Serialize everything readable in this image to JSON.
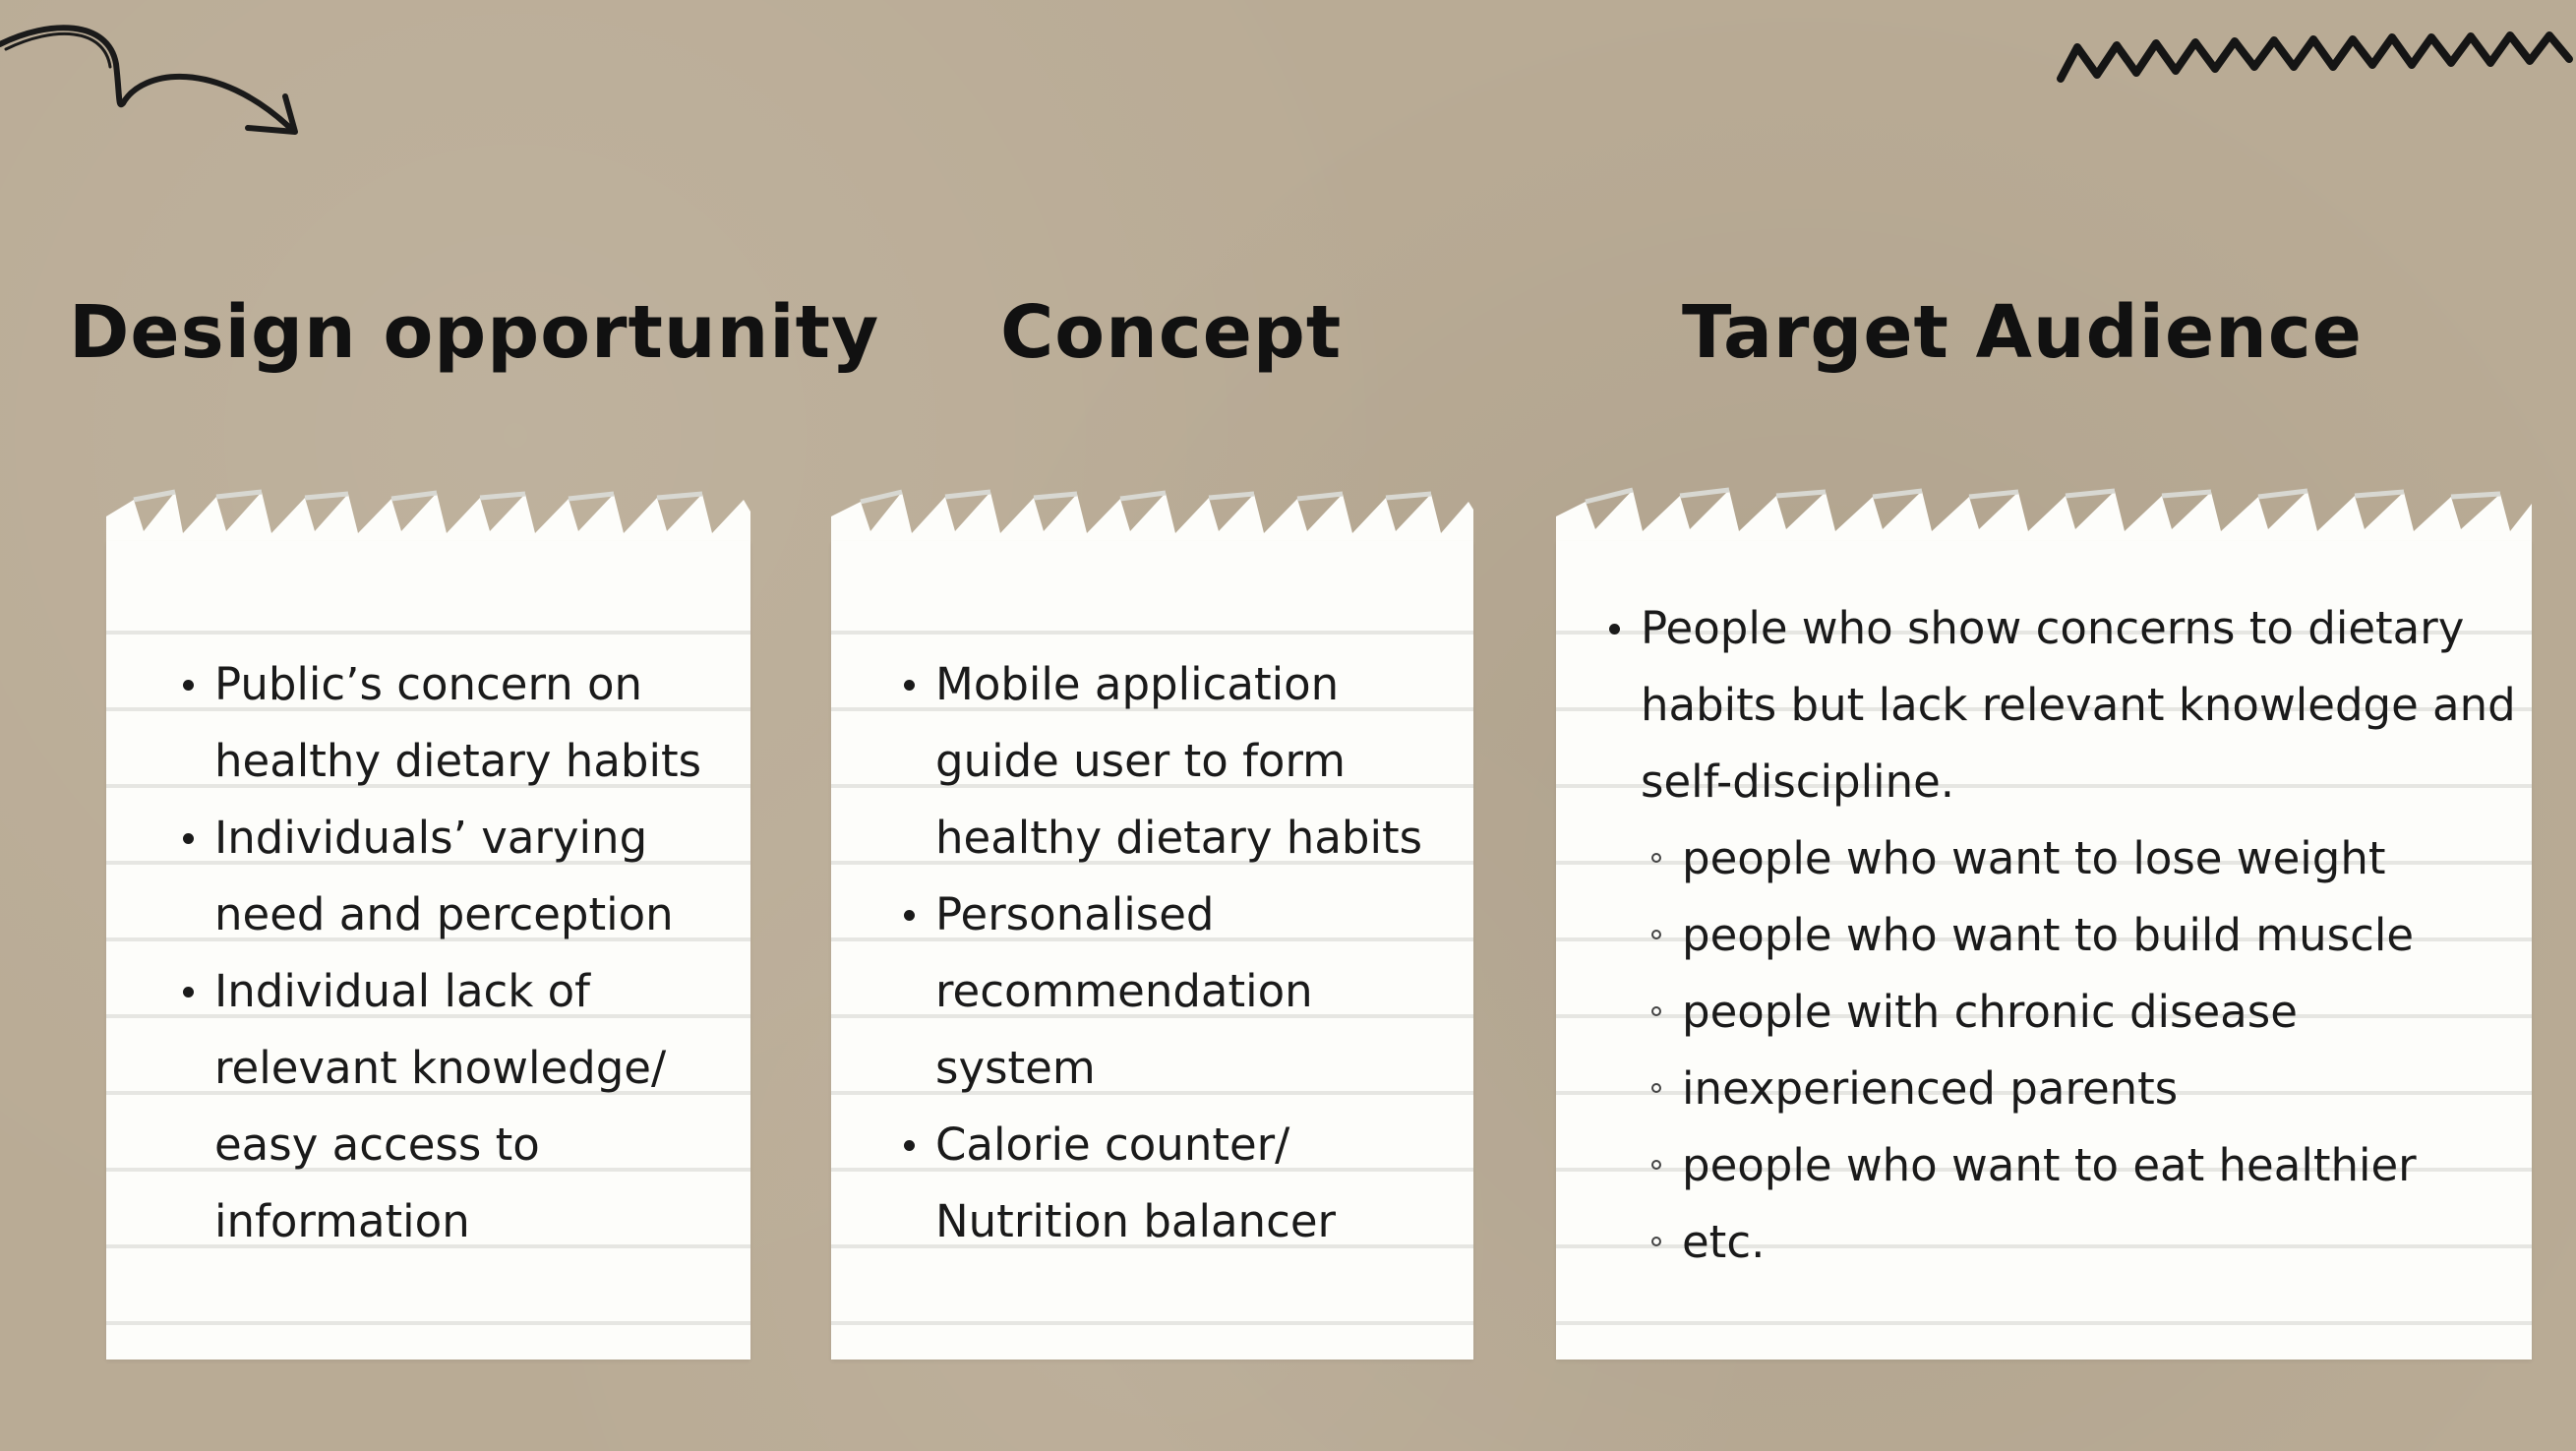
{
  "colors": {
    "background": "#b9ab95",
    "paper": "#fdfdfa",
    "rule_line": "#e6e6e2",
    "text": "#111111"
  },
  "decorations": [
    "curved-arrow-doodle",
    "zigzag-doodle"
  ],
  "sections": [
    {
      "heading": "Design opportunity",
      "items": [
        "Public’s concern on healthy dietary habits",
        "Individuals’ varying need and perception",
        "Individual lack of relevant knowledge/ easy access to information"
      ]
    },
    {
      "heading": "Concept",
      "items": [
        "Mobile application guide user to form healthy dietary habits",
        "Personalised recommendation system",
        "Calorie counter/ Nutrition balancer"
      ]
    },
    {
      "heading": "Target Audience",
      "items": [
        "People who show concerns to dietary habits but lack relevant knowledge and self-discipline."
      ],
      "sub_items": [
        "people who want to  lose weight",
        "people who want to build muscle",
        "people with chronic disease",
        "inexperienced parents",
        "people who want to eat healthier",
        "etc."
      ]
    }
  ]
}
